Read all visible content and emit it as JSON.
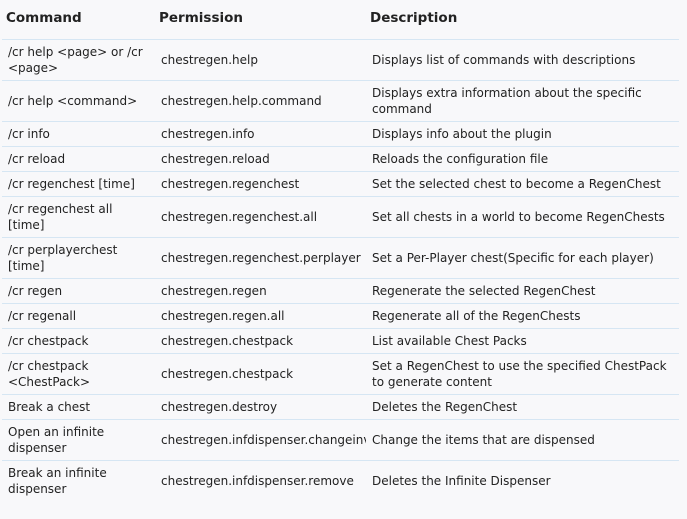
{
  "headers": {
    "command": "Command",
    "permission": "Permission",
    "description": "Description"
  },
  "rows": [
    {
      "command": "/cr help <page> or /cr <page>",
      "permission": "chestregen.help",
      "description": "Displays list of commands with descriptions"
    },
    {
      "command": "/cr help <command>",
      "permission": "chestregen.help.command",
      "description": "Displays extra information about the specific command"
    },
    {
      "command": "/cr info",
      "permission": "chestregen.info",
      "description": "Displays info about the plugin"
    },
    {
      "command": "/cr reload",
      "permission": "chestregen.reload",
      "description": "Reloads the configuration file"
    },
    {
      "command": "/cr regenchest [time]",
      "permission": "chestregen.regenchest",
      "description": "Set the selected chest to become a RegenChest"
    },
    {
      "command": "/cr regenchest all [time]",
      "permission": "chestregen.regenchest.all",
      "description": "Set all chests in a world to become RegenChests"
    },
    {
      "command": "/cr perplayerchest [time]",
      "permission": "chestregen.regenchest.perplayer",
      "description": "Set a Per-Player chest(Specific for each player)"
    },
    {
      "command": "/cr regen",
      "permission": "chestregen.regen",
      "description": "Regenerate the selected RegenChest"
    },
    {
      "command": "/cr regenall",
      "permission": "chestregen.regen.all",
      "description": "Regenerate all of the RegenChests"
    },
    {
      "command": "/cr chestpack",
      "permission": "chestregen.chestpack",
      "description": "List available Chest Packs"
    },
    {
      "command": "/cr chestpack <ChestPack>",
      "permission": "chestregen.chestpack",
      "description": "Set a RegenChest to use the specified ChestPack to generate content"
    },
    {
      "command": "Break a chest",
      "permission": "chestregen.destroy",
      "description": "Deletes the RegenChest"
    },
    {
      "command": "Open an infinite dispenser",
      "permission": "chestregen.infdispenser.changeinv",
      "description": "Change the items that are dispensed"
    },
    {
      "command": "Break an infinite dispenser",
      "permission": "chestregen.infdispenser.remove",
      "description": "Deletes the Infinite Dispenser"
    }
  ]
}
